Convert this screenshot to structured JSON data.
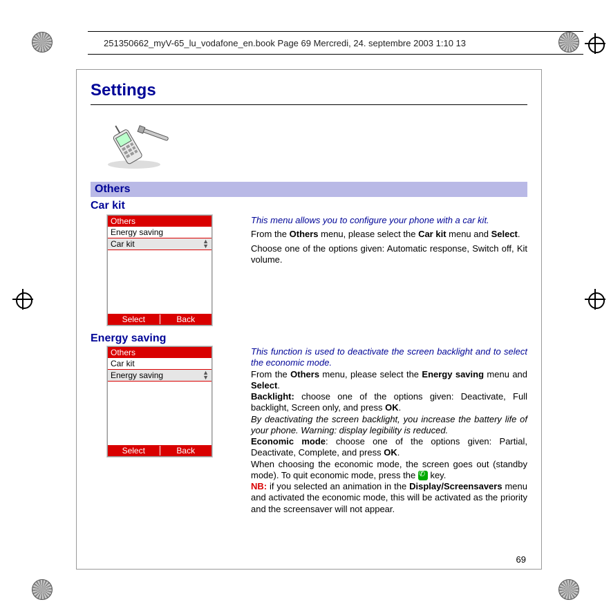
{
  "header_text": "251350662_myV-65_lu_vodafone_en.book  Page 69  Mercredi, 24. septembre 2003  1:10 13",
  "page_title": "Settings",
  "section_bar": "Others",
  "page_number": "69",
  "carkit": {
    "title": "Car kit",
    "screen": {
      "title": "Others",
      "row1": "Energy saving",
      "row2": "Car kit",
      "left_soft": "Select",
      "right_soft": "Back"
    },
    "desc_ital": "This menu allows you to configure your phone with a car kit.",
    "p1_a": "From the ",
    "p1_b": "Others",
    "p1_c": " menu, please select the ",
    "p1_d": "Car kit",
    "p1_e": " menu and ",
    "p1_f": "Select",
    "p1_g": ".",
    "p2": "Choose one of the options given: Automatic response, Switch off, Kit volume."
  },
  "energy": {
    "title": "Energy saving",
    "screen": {
      "title": "Others",
      "row1": "Car kit",
      "row2": "Energy saving",
      "left_soft": "Select",
      "right_soft": "Back"
    },
    "desc_ital": "This function is used to deactivate the screen backlight and to select the economic mode.",
    "p1_a": "From the ",
    "p1_b": "Others",
    "p1_c": " menu, please select the ",
    "p1_d": "Energy saving",
    "p1_e": " menu and ",
    "p1_f": "Select",
    "p1_g": ".",
    "p2_label": "Backlight:",
    "p2_rest": " choose one of the options given: Deactivate, Full backlight, Screen only, and press ",
    "p2_ok": "OK",
    "p2_end": ".",
    "p3_ital": "By deactivating the screen backlight, you increase the battery life of your phone. Warning: display legibility is reduced.",
    "p4_label": "Economic mode",
    "p4_rest": ": choose one of the options given: Partial, Deactivate, Complete, and press ",
    "p4_ok": "OK",
    "p4_end": ".",
    "p5": "When choosing the economic mode, the screen goes out (standby mode). To quit economic mode, press the ",
    "p5_end": " key.",
    "p6_label": "NB:",
    "p6_rest": " if you selected an animation in the ",
    "p6_menu": "Display/Screensavers",
    "p6_rest2": " menu and activated the economic mode, this will be activated as the priority and the screensaver will not appear."
  }
}
